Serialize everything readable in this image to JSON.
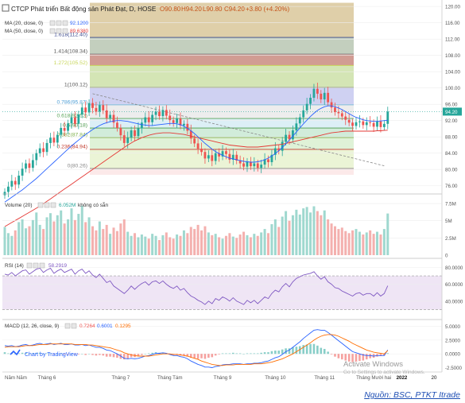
{
  "header": {
    "title": "CTCP Phát triển Bất động sản Phát Đạt, D, HOSE",
    "ohlc": {
      "open": "O90.80",
      "high": "H94.20",
      "low": "L90.80",
      "close": "C94.20",
      "change": "+3.80 (+4.20%)"
    }
  },
  "indicators": {
    "ma20": {
      "label": "MA (20, close, 0)",
      "value": "92.1200"
    },
    "ma50": {
      "label": "MA (50, close, 0)",
      "value": "89.6380"
    },
    "volume": {
      "label": "Volume (20)",
      "value": "6.052M",
      "na": "không có sẵn"
    },
    "rsi": {
      "label": "RSI (14)",
      "value": "58.2919"
    },
    "macd": {
      "label": "MACD (12, 26, close, 9)",
      "v1": "0.7264",
      "v2": "0.6001",
      "v3": "0.1295"
    }
  },
  "fib_labels": [
    {
      "text": "1.618(112.40)",
      "price": 112.4
    },
    {
      "text": "1.414(108.34)",
      "price": 108.34
    },
    {
      "text": "1.272(105.52)",
      "price": 105.52
    },
    {
      "text": "1(100.12)",
      "price": 100.12
    },
    {
      "text": "0.786(95.87)",
      "price": 95.87
    },
    {
      "text": "0.618(92.52)",
      "price": 92.52
    },
    {
      "text": "0.5(90.18)",
      "price": 90.18
    },
    {
      "text": "0.382(87.84)",
      "price": 87.84
    },
    {
      "text": "0.236(84.94)",
      "price": 84.94
    },
    {
      "text": "0(80.26)",
      "price": 80.26
    }
  ],
  "price_ticks": [
    "120.00",
    "116.00",
    "112.00",
    "108.00",
    "104.00",
    "100.00",
    "96.00",
    "92.00",
    "88.00",
    "84.00",
    "80.00",
    "76.00"
  ],
  "last_price_tag": "94.20",
  "volume_ticks": [
    "7.5M",
    "5M",
    "2.5M",
    "0"
  ],
  "rsi_ticks": [
    "80.0000",
    "60.0000",
    "40.0000"
  ],
  "macd_ticks": [
    "5.0000",
    "2.5000",
    "0.0000",
    "-2.5000"
  ],
  "x_labels": [
    "Năm Năm",
    "Tháng 6",
    "Tháng 7",
    "Tháng Tám",
    "Tháng 9",
    "Tháng 10",
    "Tháng 11",
    "Tháng Mười hai",
    "2022",
    "20"
  ],
  "watermark": {
    "line1": "Activate Windows",
    "line2": "Go to Settings to activate Windows."
  },
  "brand": "Chart by TradingView",
  "source": "Nguồn: BSC, PTKT Itrade",
  "colors": {
    "up": "#26a69a",
    "down": "#ef5350",
    "ma20": "#2962ff",
    "ma50": "#e53935",
    "rsi": "#7e57c2",
    "macd": "#2962ff",
    "signal": "#ff6d00"
  },
  "chart_data": {
    "type": "candlestick",
    "price_range": [
      74,
      121
    ],
    "closes": [
      74.5,
      75.8,
      77.2,
      76.3,
      78.5,
      80.2,
      81.5,
      80.4,
      82.3,
      84.0,
      85.2,
      84.3,
      86.5,
      87.8,
      86.6,
      88.5,
      90.2,
      89.5,
      91.3,
      92.8,
      91.2,
      93.5,
      95.2,
      94.0,
      96.3,
      95.1,
      94.2,
      95.8,
      94.5,
      92.6,
      93.4,
      91.5,
      90.2,
      88.4,
      86.5,
      87.8,
      89.6,
      88.2,
      90.1,
      91.5,
      92.8,
      91.6,
      93.4,
      94.2,
      93.1,
      94.6,
      93.2,
      92.1,
      91.4,
      92.5,
      90.8,
      91.2,
      89.5,
      87.6,
      86.4,
      85.1,
      84.3,
      82.7,
      83.5,
      82.1,
      84.0,
      83.2,
      84.5,
      83.8,
      82.4,
      83.6,
      82.2,
      81.5,
      80.7,
      81.9,
      80.8,
      81.5,
      80.4,
      81.2,
      82.5,
      81.8,
      83.6,
      85.2,
      84.6,
      86.8,
      88.5,
      87.4,
      89.6,
      91.3,
      92.8,
      94.5,
      96.1,
      97.6,
      99.8,
      98.6,
      97.2,
      98.8,
      96.5,
      95.2,
      94.1,
      93.8,
      93.0,
      92.2,
      91.5,
      90.7,
      91.6,
      91.8,
      90.9,
      91.6,
      91.4,
      90.5,
      91.8,
      90.4,
      91.2,
      94.2
    ],
    "ma20": [
      72.0,
      72.6,
      73.2,
      73.8,
      74.4,
      75.0,
      75.7,
      76.4,
      77.1,
      77.8,
      78.6,
      79.4,
      80.2,
      81.0,
      81.8,
      82.6,
      83.4,
      84.2,
      85.0,
      85.8,
      86.5,
      87.2,
      87.9,
      88.6,
      89.2,
      89.8,
      90.3,
      90.8,
      91.2,
      91.5,
      91.7,
      91.9,
      92.0,
      92.0,
      91.9,
      91.8,
      91.6,
      91.4,
      91.2,
      91.0,
      90.9,
      90.8,
      90.8,
      90.9,
      91.0,
      91.1,
      91.2,
      91.3,
      91.3,
      91.2,
      91.0,
      90.6,
      90.1,
      89.5,
      88.8,
      88.0,
      87.2,
      86.4,
      85.7,
      85.0,
      84.4,
      83.9,
      83.5,
      83.1,
      82.8,
      82.6,
      82.4,
      82.2,
      82.0,
      81.9,
      81.8,
      81.8,
      81.9,
      82.1,
      82.4,
      82.8,
      83.3,
      83.9,
      84.6,
      85.4,
      86.3,
      87.2,
      88.2,
      89.2,
      90.2,
      91.2,
      92.1,
      93.0,
      93.8,
      94.5,
      95.0,
      95.4,
      95.6,
      95.6,
      95.4,
      95.1,
      94.7,
      94.2,
      93.7,
      93.2,
      92.8,
      92.5,
      92.2,
      92.0,
      91.9,
      91.8,
      91.8,
      91.9,
      92.0,
      92.1
    ],
    "ma50": [
      66.0,
      66.5,
      67.0,
      67.5,
      68.0,
      68.5,
      69.0,
      69.5,
      70.0,
      70.5,
      71.0,
      71.6,
      72.2,
      72.8,
      73.4,
      74.0,
      74.6,
      75.2,
      75.8,
      76.4,
      77.0,
      77.6,
      78.2,
      78.8,
      79.4,
      80.0,
      80.6,
      81.2,
      81.8,
      82.4,
      83.0,
      83.6,
      84.2,
      84.8,
      85.4,
      86.0,
      86.5,
      87.0,
      87.4,
      87.8,
      88.1,
      88.4,
      88.6,
      88.8,
      88.9,
      89.0,
      89.0,
      89.0,
      88.9,
      88.8,
      88.7,
      88.6,
      88.4,
      88.2,
      88.0,
      87.8,
      87.6,
      87.4,
      87.2,
      87.0,
      86.8,
      86.6,
      86.4,
      86.2,
      86.0,
      85.9,
      85.8,
      85.7,
      85.6,
      85.5,
      85.5,
      85.5,
      85.5,
      85.6,
      85.7,
      85.8,
      85.9,
      86.0,
      86.1,
      86.2,
      86.4,
      86.6,
      86.8,
      87.0,
      87.2,
      87.4,
      87.6,
      87.8,
      88.0,
      88.2,
      88.4,
      88.6,
      88.8,
      89.0,
      89.1,
      89.2,
      89.3,
      89.4,
      89.4,
      89.4,
      89.4,
      89.4,
      89.4,
      89.4,
      89.4,
      89.4,
      89.5,
      89.5,
      89.6,
      89.638
    ],
    "volume_range": [
      0,
      8.2
    ],
    "volume": [
      4.1,
      3.2,
      2.8,
      3.6,
      4.8,
      5.2,
      3.9,
      4.2,
      5.1,
      6.2,
      4.4,
      3.8,
      5.5,
      6.1,
      4.9,
      5.8,
      6.5,
      4.6,
      5.2,
      6.8,
      5.1,
      6.0,
      7.2,
      4.8,
      5.5,
      4.2,
      3.6,
      4.9,
      3.8,
      4.4,
      3.1,
      4.0,
      3.5,
      4.6,
      5.2,
      3.4,
      2.8,
      3.2,
      2.6,
      3.0,
      2.7,
      2.4,
      3.1,
      2.8,
      2.2,
      2.9,
      3.3,
      2.6,
      2.4,
      3.0,
      2.8,
      3.6,
      3.2,
      4.1,
      3.8,
      4.4,
      3.6,
      4.2,
      3.3,
      2.9,
      3.1,
      2.6,
      2.4,
      2.8,
      3.2,
      2.7,
      2.5,
      3.0,
      3.4,
      2.9,
      2.6,
      3.1,
      2.8,
      3.3,
      3.8,
      3.2,
      4.5,
      5.2,
      4.1,
      5.6,
      6.4,
      5.0,
      5.8,
      6.6,
      5.9,
      6.8,
      7.0,
      6.2,
      7.1,
      6.4,
      5.8,
      6.5,
      5.2,
      4.6,
      4.2,
      3.8,
      4.0,
      3.5,
      3.2,
      3.6,
      3.8,
      3.4,
      3.0,
      3.3,
      3.6,
      3.1,
      3.4,
      3.0,
      3.8,
      6.052
    ],
    "rsi_range": [
      20,
      88
    ],
    "rsi": [
      72,
      71,
      74,
      70,
      73,
      76,
      77,
      72,
      75,
      78,
      79,
      74,
      77,
      79,
      73,
      76,
      78,
      74,
      76,
      78,
      72,
      76,
      78,
      73,
      76,
      71,
      68,
      72,
      67,
      62,
      64,
      58,
      55,
      52,
      49,
      53,
      58,
      54,
      58,
      61,
      63,
      59,
      63,
      64,
      61,
      64,
      60,
      57,
      55,
      58,
      53,
      55,
      50,
      46,
      44,
      41,
      39,
      36,
      40,
      37,
      43,
      41,
      45,
      43,
      40,
      44,
      40,
      38,
      36,
      41,
      38,
      41,
      37,
      41,
      45,
      43,
      49,
      53,
      51,
      57,
      61,
      57,
      63,
      67,
      69,
      71,
      72,
      73,
      75,
      70,
      66,
      69,
      63,
      60,
      56,
      55,
      52,
      50,
      48,
      46,
      49,
      50,
      47,
      49,
      49,
      46,
      50,
      46,
      49,
      58.2919
    ],
    "macd_range": [
      -3.0,
      5.8
    ],
    "macd": [
      1.5,
      1.4,
      1.5,
      1.3,
      1.4,
      1.6,
      1.7,
      1.5,
      1.6,
      1.8,
      1.9,
      1.7,
      1.8,
      1.9,
      1.7,
      1.8,
      1.9,
      1.7,
      1.7,
      1.8,
      1.6,
      1.6,
      1.7,
      1.5,
      1.6,
      1.4,
      1.2,
      1.2,
      1.0,
      0.7,
      0.6,
      0.3,
      0.0,
      -0.4,
      -0.8,
      -0.9,
      -0.8,
      -0.9,
      -0.8,
      -0.6,
      -0.4,
      -0.3,
      -0.1,
      0.1,
      0.1,
      0.2,
      0.1,
      -0.1,
      -0.3,
      -0.3,
      -0.5,
      -0.6,
      -0.9,
      -1.3,
      -1.6,
      -1.9,
      -2.1,
      -2.4,
      -2.4,
      -2.5,
      -2.3,
      -2.2,
      -2.0,
      -1.9,
      -1.9,
      -1.8,
      -1.8,
      -1.8,
      -1.9,
      -1.8,
      -1.8,
      -1.7,
      -1.7,
      -1.6,
      -1.4,
      -1.3,
      -1.0,
      -0.7,
      -0.5,
      -0.1,
      0.4,
      0.7,
      1.2,
      1.7,
      2.2,
      2.8,
      3.3,
      3.8,
      4.3,
      4.4,
      4.3,
      4.3,
      3.9,
      3.4,
      2.9,
      2.4,
      1.9,
      1.4,
      0.9,
      0.4,
      0.2,
      0.0,
      -0.2,
      -0.3,
      -0.3,
      -0.4,
      -0.3,
      -0.3,
      -0.3,
      0.7264
    ],
    "signal": [
      1.2,
      1.3,
      1.3,
      1.3,
      1.3,
      1.4,
      1.5,
      1.5,
      1.5,
      1.6,
      1.7,
      1.7,
      1.7,
      1.8,
      1.8,
      1.8,
      1.8,
      1.8,
      1.8,
      1.8,
      1.7,
      1.7,
      1.7,
      1.7,
      1.6,
      1.6,
      1.5,
      1.4,
      1.3,
      1.2,
      1.1,
      0.9,
      0.7,
      0.5,
      0.2,
      0.0,
      -0.2,
      -0.3,
      -0.4,
      -0.4,
      -0.4,
      -0.4,
      -0.3,
      -0.2,
      -0.1,
      0.0,
      0.0,
      0.0,
      -0.1,
      -0.1,
      -0.2,
      -0.3,
      -0.4,
      -0.6,
      -0.8,
      -1.0,
      -1.3,
      -1.5,
      -1.7,
      -1.9,
      -2.0,
      -2.1,
      -2.1,
      -2.0,
      -2.0,
      -2.0,
      -1.9,
      -1.9,
      -1.9,
      -1.9,
      -1.9,
      -1.8,
      -1.8,
      -1.8,
      -1.7,
      -1.6,
      -1.5,
      -1.3,
      -1.1,
      -0.9,
      -0.6,
      -0.3,
      0.0,
      0.4,
      0.8,
      1.2,
      1.6,
      2.0,
      2.5,
      2.9,
      3.2,
      3.4,
      3.5,
      3.5,
      3.4,
      3.2,
      2.9,
      2.6,
      2.3,
      1.9,
      1.6,
      1.3,
      1.0,
      0.7,
      0.5,
      0.3,
      0.2,
      0.1,
      0.0,
      0.6001
    ],
    "x_tick_index": [
      0,
      12,
      33,
      47,
      62,
      77,
      91,
      105,
      113,
      124
    ],
    "trendline": {
      "from": [
        25,
        98.6
      ],
      "to": [
        108,
        80.9
      ]
    }
  }
}
